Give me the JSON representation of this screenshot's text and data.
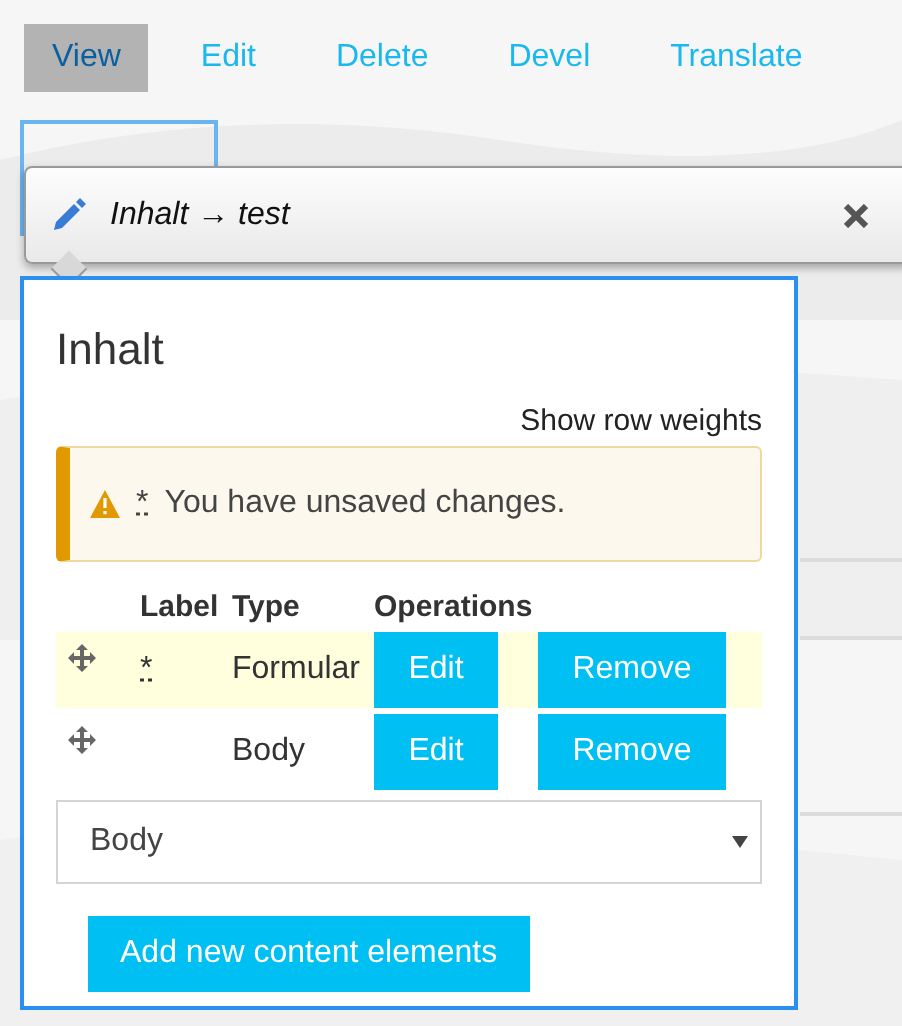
{
  "tabs": [
    {
      "label": "View",
      "selected": true
    },
    {
      "label": "Edit",
      "selected": false
    },
    {
      "label": "Delete",
      "selected": false
    },
    {
      "label": "Devel",
      "selected": false
    },
    {
      "label": "Translate",
      "selected": false
    }
  ],
  "dialog": {
    "title": "Inhalt → test"
  },
  "panel": {
    "heading": "Inhalt",
    "row_weights_link": "Show row weights",
    "warning": {
      "marker": "*",
      "message": "You have unsaved changes."
    },
    "table": {
      "columns": [
        "Label",
        "Type",
        "Operations"
      ],
      "rows": [
        {
          "changed": true,
          "marker": "*",
          "type": "Formular",
          "actions": [
            "Edit",
            "Remove"
          ]
        },
        {
          "changed": false,
          "type": "Body",
          "actions": [
            "Edit",
            "Remove"
          ]
        }
      ]
    },
    "select": {
      "value": "Body"
    },
    "add_button": "Add new content elements"
  }
}
